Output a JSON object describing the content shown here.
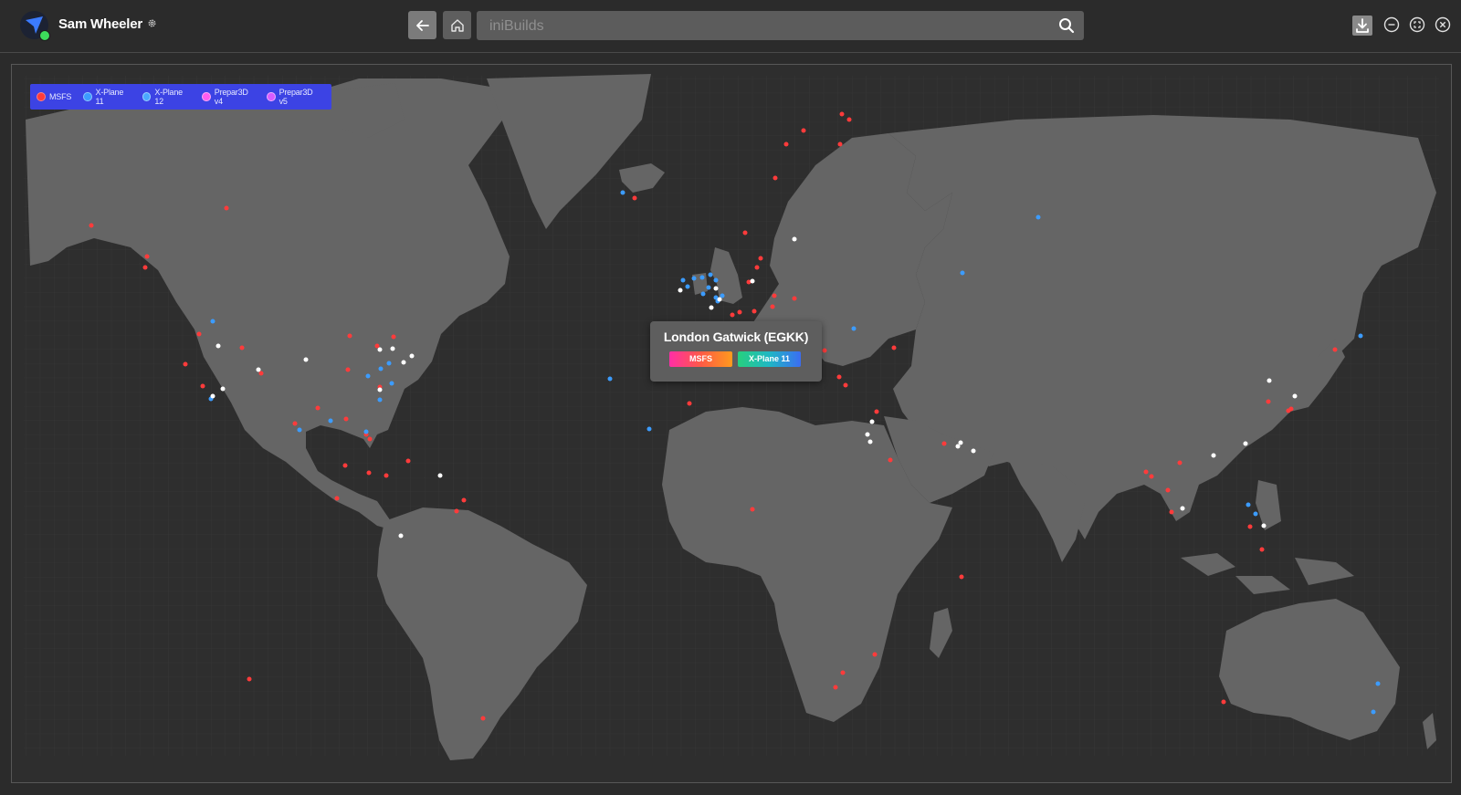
{
  "titlebar": {
    "user_name": "Sam Wheeler",
    "avatar_icon": "ini-plane-logo-icon",
    "status": "online",
    "search_placeholder": "iniBuilds"
  },
  "legend": {
    "items": [
      {
        "label": "MSFS",
        "color": "#ff3b3b"
      },
      {
        "label": "X-Plane 11",
        "color": "#3c9cff"
      },
      {
        "label": "X-Plane 12",
        "color": "#4aa8ff"
      },
      {
        "label": "Prepar3D v4",
        "color": "#ff5cf0"
      },
      {
        "label": "Prepar3D v5",
        "color": "#d85cff"
      }
    ]
  },
  "tooltip": {
    "title": "London Gatwick (EGKK)",
    "tags": [
      "MSFS",
      "X-Plane 11"
    ]
  },
  "colors": {
    "background": "#2b2b2b",
    "land": "#656565",
    "ocean": "#2e2e2e",
    "legend": "#3c43e4",
    "msfs_marker": "#ff3b3b",
    "xplane_marker": "#3c9cff",
    "multi_marker": "#ffffff"
  }
}
